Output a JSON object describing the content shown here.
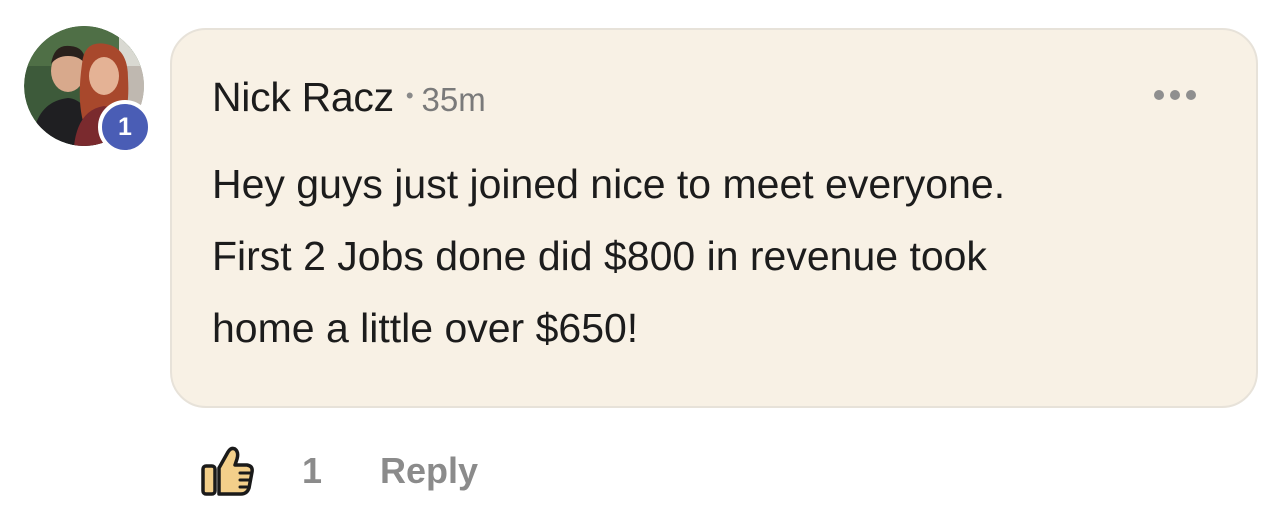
{
  "comment": {
    "author": "Nick Racz",
    "separator": "•",
    "time": "35m",
    "avatar_badge": "1",
    "body_lines": [
      "Hey guys just joined nice to meet everyone.",
      "First 2 Jobs done did $800 in revenue took",
      "home a little over $650!"
    ],
    "menu_icon": "more-horizontal-icon"
  },
  "actions": {
    "like_icon": "thumbs-up-icon",
    "like_count": "1",
    "reply_label": "Reply"
  },
  "colors": {
    "bubble_background": "#f8f1e5",
    "badge": "#4a5db5",
    "like_icon_fill": "#f3cf8a",
    "muted_text": "#8b8b8b"
  }
}
